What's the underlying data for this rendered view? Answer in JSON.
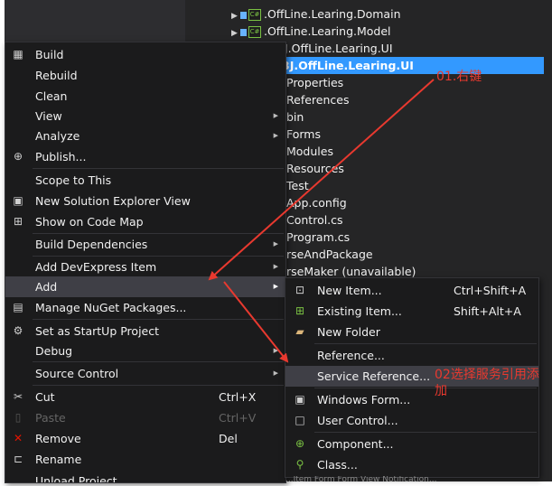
{
  "tree": {
    "top_nodes": [
      ".OffLine.Learing.Domain",
      ".OffLine.Learing.Model"
    ],
    "rows": [
      "J.OffLine.Learing.UI",
      "3J.OffLine.Learing.UI",
      "Properties",
      "References",
      "bin",
      "Forms",
      "Modules",
      "Resources",
      "Test",
      "App.config",
      "Control.cs",
      "Program.cs",
      "rseAndPackage",
      "rseMaker (unavailable)"
    ],
    "csharp_badge": "C#",
    "bottom_text": "...Item   Form   Form   View   Notification..."
  },
  "context_menu": {
    "build": "Build",
    "rebuild": "Rebuild",
    "clean": "Clean",
    "view": "View",
    "analyze": "Analyze",
    "publish": "Publish...",
    "scope_to_this": "Scope to This",
    "new_solution_explorer_view": "New Solution Explorer View",
    "show_on_code_map": "Show on Code Map",
    "build_dependencies": "Build Dependencies",
    "add_devexpress_item": "Add DevExpress Item",
    "add": "Add",
    "manage_nuget": "Manage NuGet Packages...",
    "set_startup": "Set as StartUp Project",
    "debug": "Debug",
    "source_control": "Source Control",
    "cut": "Cut",
    "cut_shortcut": "Ctrl+X",
    "paste": "Paste",
    "paste_shortcut": "Ctrl+V",
    "remove": "Remove",
    "remove_shortcut": "Del",
    "rename": "Rename",
    "unload_project": "Unload Project"
  },
  "add_submenu": {
    "new_item": "New Item...",
    "new_item_shortcut": "Ctrl+Shift+A",
    "existing_item": "Existing Item...",
    "existing_item_shortcut": "Shift+Alt+A",
    "new_folder": "New Folder",
    "reference": "Reference...",
    "service_reference": "Service Reference...",
    "windows_form": "Windows Form...",
    "user_control": "User Control...",
    "component": "Component...",
    "class": "Class..."
  },
  "annotations": {
    "step1": "01.右键",
    "step2": "02选择服务引用添加"
  },
  "colors": {
    "selection": "#3399ff",
    "menu_bg": "#1b1b1c",
    "highlight": "#3f3f46",
    "annotation_red": "#e8392f"
  }
}
